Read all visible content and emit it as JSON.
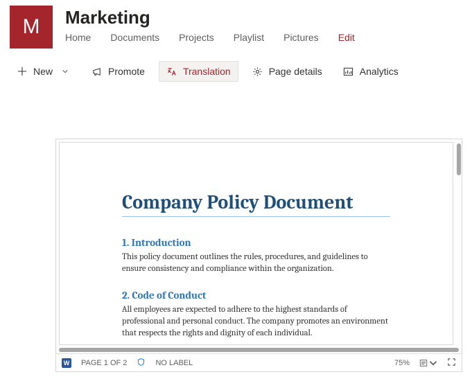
{
  "site": {
    "logo_letter": "M",
    "title": "Marketing",
    "nav": {
      "home": "Home",
      "documents": "Documents",
      "projects": "Projects",
      "playlist": "Playlist",
      "pictures": "Pictures",
      "edit": "Edit"
    }
  },
  "toolbar": {
    "new": "New",
    "promote": "Promote",
    "translation": "Translation",
    "page_details": "Page details",
    "analytics": "Analytics"
  },
  "document": {
    "title": "Company Policy Document",
    "sections": {
      "s1": {
        "heading": "1. Introduction",
        "body": "This policy document outlines the rules, procedures, and guidelines to ensure consistency and compliance within the organization."
      },
      "s2": {
        "heading": "2. Code of Conduct",
        "body": "All employees are expected to adhere to the highest standards of professional and personal conduct. The company promotes an environment that respects the rights and dignity of each individual."
      }
    }
  },
  "status": {
    "page": "PAGE 1 OF 2",
    "label": "NO LABEL",
    "zoom": "75%"
  }
}
